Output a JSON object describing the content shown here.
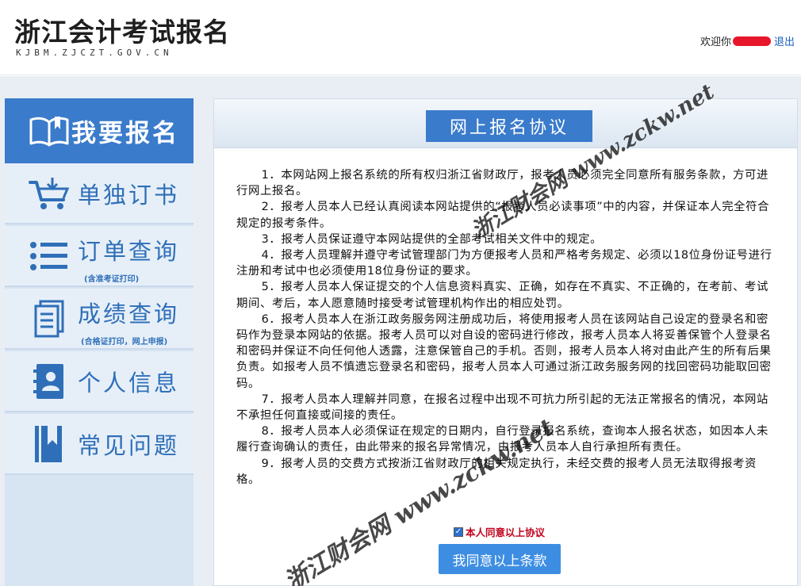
{
  "header": {
    "title": "浙江会计考试报名",
    "subtitle": "KJBM.ZJCZT.GOV.CN",
    "welcome": "欢迎你",
    "logout": "退出"
  },
  "sidebar": {
    "items": [
      {
        "label": "我要报名",
        "icon": "open-book-icon",
        "active": true
      },
      {
        "label": "单独订书",
        "icon": "cart-icon"
      },
      {
        "label": "订单查询",
        "sub": "(含准考证打印)",
        "icon": "list-icon"
      },
      {
        "label": "成绩查询",
        "sub": "(合格证打印，网上申报)",
        "icon": "document-icon"
      },
      {
        "label": "个人信息",
        "icon": "contact-book-icon"
      },
      {
        "label": "常见问题",
        "icon": "bookmark-book-icon"
      }
    ]
  },
  "main": {
    "title": "网上报名协议",
    "paragraphs": [
      "1．本网站网上报名系统的所有权归浙江省财政厅，报考人员必须完全同意所有服务条款，方可进行网上报名。",
      "2．报考人员本人已经认真阅读本网站提供的“报考人员必读事项”中的内容，并保证本人完全符合规定的报考条件。",
      "3．报考人员保证遵守本网站提供的全部考试相关文件中的规定。",
      "4．报考人员理解并遵守考试管理部门为方便报考人员和严格考务规定、必须以18位身份证号进行注册和考试中也必须使用18位身份证的要求。",
      "5．报考人员本人保证提交的个人信息资料真实、正确，如存在不真实、不正确的，在考前、考试期间、考后，本人愿意随时接受考试管理机构作出的相应处罚。",
      "6．报考人员本人在浙江政务服务网注册成功后，将使用报考人员在该网站自己设定的登录名和密码作为登录本网站的依据。报考人员可以对自设的密码进行修改，报考人员本人将妥善保管个人登录名和密码并保证不向任何他人透露，注意保管自己的手机。否则，报考人员本人将对由此产生的所有后果负责。如报考人员不慎遗忘登录名和密码，报考人员本人可通过浙江政务服务网的找回密码功能取回密码。",
      "7．报考人员本人理解并同意，在报名过程中出现不可抗力所引起的无法正常报名的情况，本网站不承担任何直接或间接的责任。",
      "8．报考人员本人必须保证在规定的日期内，自行登录报名系统，查询本人报名状态，如因本人未履行查询确认的责任，由此带来的报名异常情况，由报考人员本人自行承担所有责任。",
      "9．报考人员的交费方式按浙江省财政厅的相关规定执行，未经交费的报考人员无法取得报考资格。"
    ],
    "agree_checkbox_label": "本人同意以上协议",
    "agree_checked": true,
    "agree_button": "我同意以上条款"
  },
  "watermarks": [
    "浙江财会网 www.zckw.net",
    "浙江财会网 www.zckw.net"
  ],
  "colors": {
    "accent": "#3a7bcb",
    "nav_text": "#2f6fb8",
    "button": "#3d8ee2",
    "agree_label": "#c0001b",
    "logout_link": "#1a5fc0"
  }
}
